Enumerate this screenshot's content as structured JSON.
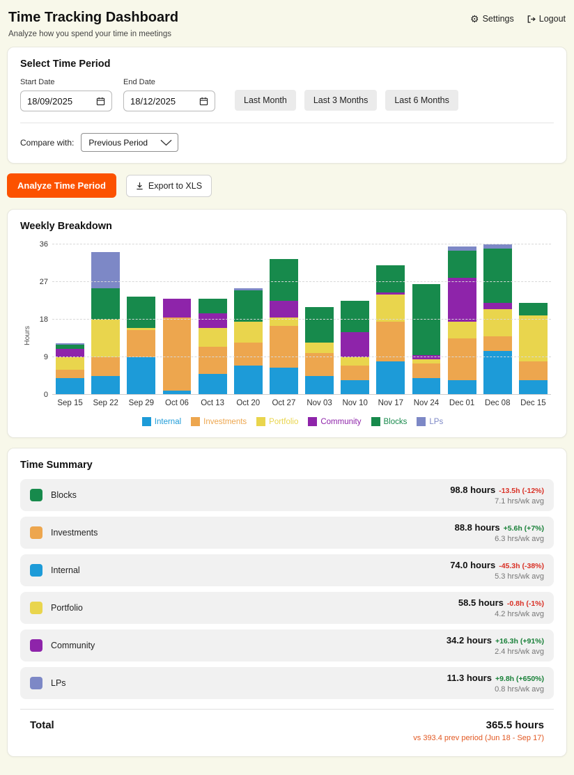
{
  "header": {
    "title": "Time Tracking Dashboard",
    "subtitle": "Analyze how you spend your time in meetings",
    "settings_label": "Settings",
    "logout_label": "Logout"
  },
  "period_card": {
    "heading": "Select Time Period",
    "start_label": "Start Date",
    "end_label": "End Date",
    "start_value": "18/09/2025",
    "end_value": "18/12/2025",
    "quick_buttons": [
      "Last Month",
      "Last 3 Months",
      "Last 6 Months"
    ],
    "compare_label": "Compare with:",
    "compare_value": "Previous Period"
  },
  "actions": {
    "analyze_label": "Analyze Time Period",
    "export_label": "Export to XLS"
  },
  "chart_card": {
    "title": "Weekly Breakdown"
  },
  "chart_data": {
    "type": "bar",
    "stacked": true,
    "title": "Weekly Breakdown",
    "xlabel": "",
    "ylabel": "Hours",
    "ylim": [
      0,
      36
    ],
    "yticks": [
      0,
      9,
      18,
      27,
      36
    ],
    "grid": "dashed-horizontal",
    "legend_position": "bottom",
    "categories": [
      "Sep 15",
      "Sep 22",
      "Sep 29",
      "Oct 06",
      "Oct 13",
      "Oct 20",
      "Oct 27",
      "Nov 03",
      "Nov 10",
      "Nov 17",
      "Nov 24",
      "Dec 01",
      "Dec 08",
      "Dec 15"
    ],
    "series": [
      {
        "name": "Internal",
        "color": "#1d9bd8",
        "values": [
          4,
          4.5,
          9,
          1,
          5,
          7,
          6.5,
          4.5,
          3.5,
          8,
          4,
          3.5,
          10.5,
          3.5
        ]
      },
      {
        "name": "Investments",
        "color": "#eda64e",
        "values": [
          2,
          4.5,
          6.5,
          17.5,
          6.5,
          5.5,
          10,
          5.5,
          3.5,
          9.5,
          3.5,
          10,
          3.5,
          4.5
        ]
      },
      {
        "name": "Portfolio",
        "color": "#e9d54d",
        "values": [
          3,
          9,
          0.5,
          0,
          4.5,
          5,
          2,
          2.5,
          2,
          6.5,
          1,
          4,
          6.5,
          11
        ]
      },
      {
        "name": "Community",
        "color": "#8e24aa",
        "values": [
          2,
          0,
          0,
          4.5,
          3.5,
          0,
          4,
          0,
          6,
          0.5,
          1,
          10.5,
          1.5,
          0
        ]
      },
      {
        "name": "Blocks",
        "color": "#178a4c",
        "values": [
          1,
          7.5,
          7.5,
          0,
          3.5,
          7.5,
          10,
          8.5,
          7.5,
          6.5,
          17,
          6.5,
          13,
          3
        ]
      },
      {
        "name": "LPs",
        "color": "#7d88c6",
        "values": [
          0.3,
          8.7,
          0,
          0,
          0,
          0.5,
          0,
          0,
          0,
          0,
          0,
          1,
          1,
          0
        ]
      }
    ]
  },
  "summary_card": {
    "title": "Time Summary",
    "rows": [
      {
        "name": "Blocks",
        "color": "#178a4c",
        "hours": "98.8 hours",
        "delta": "-13.5h (-12%)",
        "delta_dir": "down",
        "avg": "7.1 hrs/wk avg"
      },
      {
        "name": "Investments",
        "color": "#eda64e",
        "hours": "88.8 hours",
        "delta": "+5.6h (+7%)",
        "delta_dir": "up",
        "avg": "6.3 hrs/wk avg"
      },
      {
        "name": "Internal",
        "color": "#1d9bd8",
        "hours": "74.0 hours",
        "delta": "-45.3h (-38%)",
        "delta_dir": "down",
        "avg": "5.3 hrs/wk avg"
      },
      {
        "name": "Portfolio",
        "color": "#e9d54d",
        "hours": "58.5 hours",
        "delta": "-0.8h (-1%)",
        "delta_dir": "down",
        "avg": "4.2 hrs/wk avg"
      },
      {
        "name": "Community",
        "color": "#8e24aa",
        "hours": "34.2 hours",
        "delta": "+16.3h (+91%)",
        "delta_dir": "up",
        "avg": "2.4 hrs/wk avg"
      },
      {
        "name": "LPs",
        "color": "#7d88c6",
        "hours": "11.3 hours",
        "delta": "+9.8h (+650%)",
        "delta_dir": "up",
        "avg": "0.8 hrs/wk avg"
      }
    ],
    "total": {
      "label": "Total",
      "value": "365.5 hours",
      "note": "vs 393.4 prev period (Jun 18 - Sep 17)"
    }
  },
  "colors": {
    "page_background": "#f8f8ea",
    "accent_orange": "#fc5200",
    "delta_up_green": "#188038",
    "delta_down_red": "#d93025",
    "total_note_red": "#e25822"
  },
  "icons": {
    "settings": "gear-icon",
    "logout": "logout-icon",
    "date": "calendar-icon",
    "select": "chevron-down-icon",
    "export": "download-icon"
  }
}
